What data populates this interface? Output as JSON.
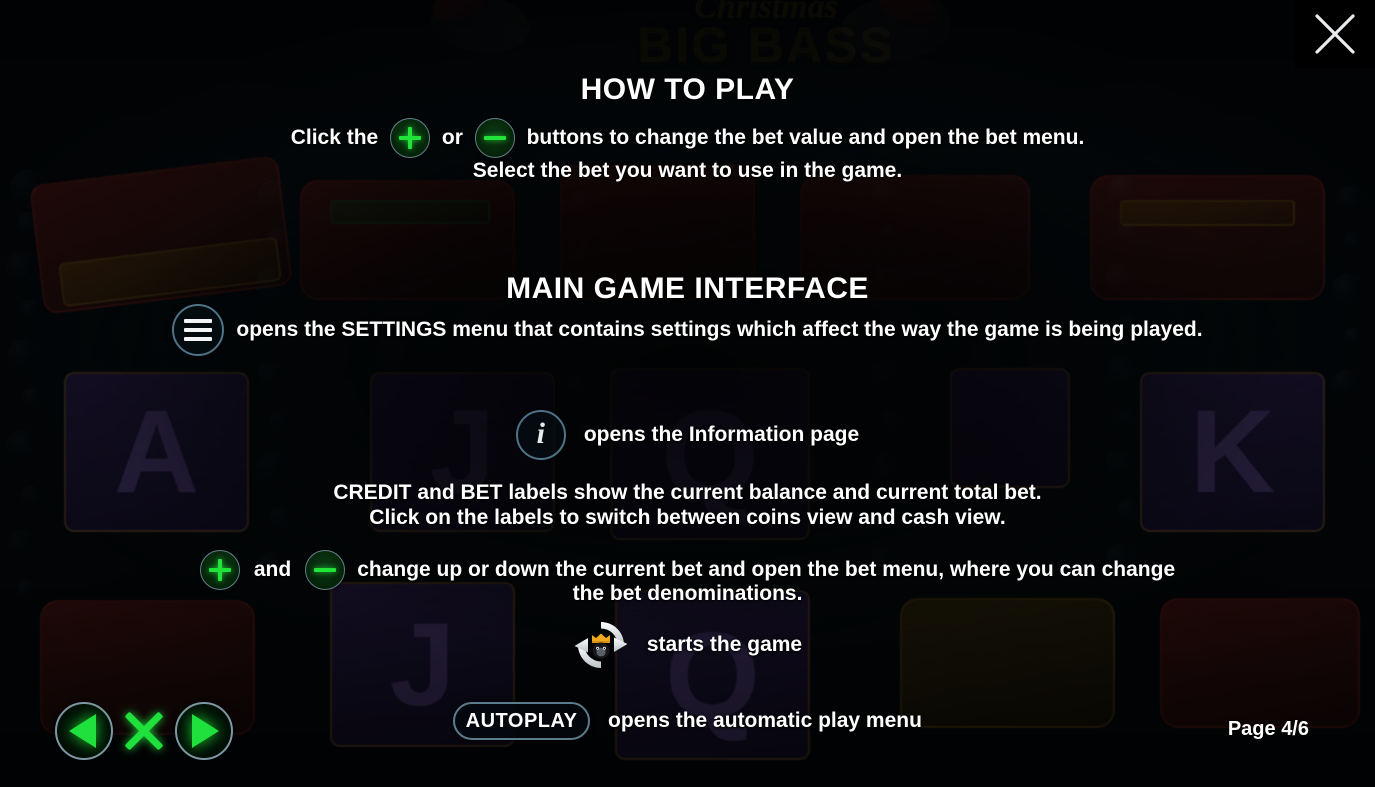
{
  "window": {
    "game_title_line1": "Christmas",
    "game_title_line2": "BIG BASS",
    "close_icon": "close-icon"
  },
  "sections": {
    "how_to_play": {
      "heading": "HOW TO PLAY",
      "line1_prefix": "Click the ",
      "line1_mid": " or ",
      "line1_suffix": " buttons to change the bet value and open the bet menu.",
      "line2": "Select the bet you want to use in the game.",
      "plus_icon": "plus-icon",
      "minus_icon": "minus-icon"
    },
    "main_game_interface": {
      "heading": "MAIN GAME INTERFACE",
      "settings": {
        "icon": "hamburger-menu-icon",
        "text": "opens the SETTINGS menu that contains settings which affect the way the game is being played."
      },
      "info": {
        "icon": "info-icon",
        "text": "opens the Information page"
      },
      "credit_bet": {
        "line1": "CREDIT and BET labels show the current balance and current total bet.",
        "line2": "Click on the labels to switch between coins view and cash view."
      },
      "bet_controls": {
        "plus_icon": "plus-icon",
        "conjunction": "and",
        "minus_icon": "minus-icon",
        "line1": "change up or down the current bet and open the bet menu, where you can change",
        "line2": "the bet denominations."
      },
      "spin": {
        "icon": "spin-button-icon",
        "text": "starts the game"
      },
      "autoplay": {
        "label": "AUTOPLAY",
        "text": "opens the automatic play menu"
      }
    }
  },
  "footer": {
    "prev_icon": "previous-page-icon",
    "close_icon": "close-paytable-icon",
    "next_icon": "next-page-icon",
    "page_label": "Page 4/6"
  },
  "colors": {
    "accent_green": "#1fe03c",
    "ring_blue": "#4e7287",
    "text_white": "#ffffff",
    "background": "#05090c"
  }
}
